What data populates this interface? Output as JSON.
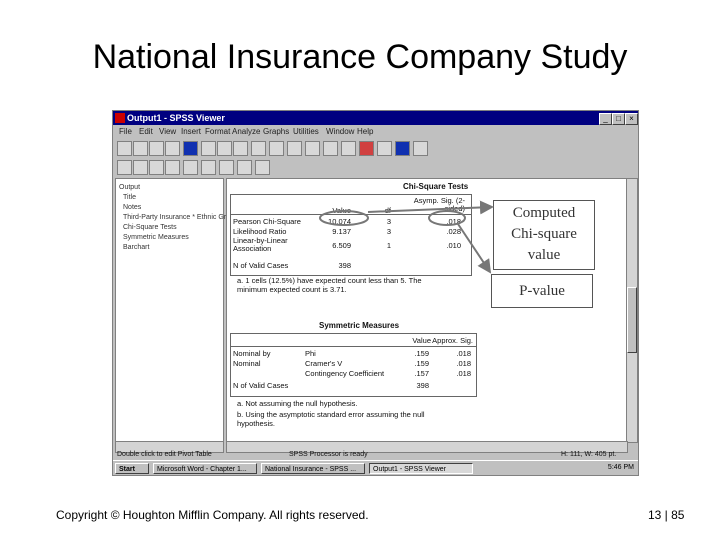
{
  "slide": {
    "title": "National Insurance Company Study",
    "footer_left": "Copyright © Houghton Mifflin Company. All rights reserved.",
    "footer_right": "13 | 85"
  },
  "window": {
    "title": "Output1 - SPSS Viewer",
    "menu": [
      "File",
      "Edit",
      "View",
      "Insert",
      "Format",
      "Analyze",
      "Graphs",
      "Utilities",
      "Window",
      "Help"
    ],
    "min_glyph": "_",
    "max_glyph": "□",
    "close_glyph": "×"
  },
  "outline": {
    "items": [
      "Output",
      "Title",
      "Notes",
      "Third-Party Insurance * Ethnic Group",
      "Chi-Square Tests",
      "Symmetric Measures",
      "Barchart"
    ]
  },
  "chi_square": {
    "title": "Chi-Square Tests",
    "columns": [
      "Value",
      "df",
      "Asymp. Sig. (2-sided)"
    ],
    "rows": [
      {
        "label": "Pearson Chi-Square",
        "value": "10.074",
        "df": "3",
        "sig": ".018"
      },
      {
        "label": "Likelihood Ratio",
        "value": "9.137",
        "df": "3",
        "sig": ".028"
      },
      {
        "label": "Linear-by-Linear Association",
        "value": "6.509",
        "df": "1",
        "sig": ".010"
      },
      {
        "label": "N of Valid Cases",
        "value": "398",
        "df": "",
        "sig": ""
      }
    ],
    "footnote": "a. 1 cells (12.5%) have expected count less than 5. The minimum expected count is 3.71."
  },
  "symmetric": {
    "title": "Symmetric Measures",
    "columns": [
      "Value",
      "Approx. Sig."
    ],
    "rows": [
      {
        "group": "Nominal by",
        "label": "Phi",
        "value": ".159",
        "sig": ".018"
      },
      {
        "group": "Nominal",
        "label": "Cramer's V",
        "value": ".159",
        "sig": ".018"
      },
      {
        "group": "",
        "label": "Contingency Coefficient",
        "value": ".157",
        "sig": ".018"
      },
      {
        "group": "N of Valid Cases",
        "label": "",
        "value": "398",
        "sig": ""
      }
    ],
    "note_a": "a. Not assuming the null hypothesis.",
    "note_b": "b. Using the asymptotic standard error assuming the null hypothesis."
  },
  "status": {
    "hint": "Double click to edit Pivot Table",
    "processor": "SPSS Processor is ready",
    "size": "H: 111, W: 405 pt."
  },
  "taskbar": {
    "start": "Start",
    "tasks": [
      "Microsoft Word - Chapter 1...",
      "National Insurance - SPSS ...",
      "Output1 - SPSS Viewer"
    ],
    "clock": "5:46 PM"
  },
  "callouts": {
    "chi": "Computed\nChi-square\nvalue",
    "p": "P-value"
  },
  "colors": {
    "titlebar": "#000080",
    "window": "#c0c0c0"
  }
}
